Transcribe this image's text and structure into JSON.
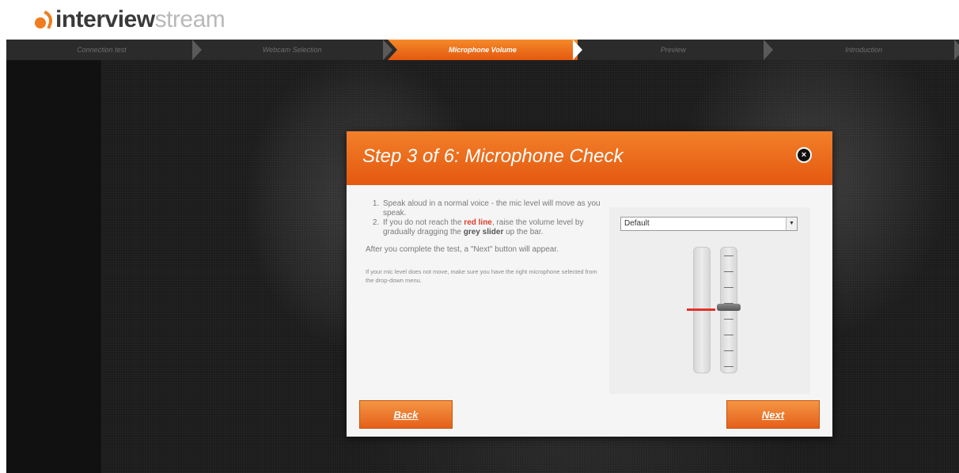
{
  "logo": {
    "strong": "interview",
    "light": "stream"
  },
  "steps": [
    {
      "label": "Connection test"
    },
    {
      "label": "Webcam Selection"
    },
    {
      "label": "Microphone Volume"
    },
    {
      "label": "Preview"
    },
    {
      "label": "Introduction"
    }
  ],
  "active_step_index": 2,
  "dialog": {
    "title": "Step 3 of 6: Microphone Check",
    "close_symbol": "×",
    "instructions": {
      "item1": "Speak aloud in a normal voice - the mic level will move as you speak.",
      "item2_a": "If you do not reach the ",
      "item2_red": "red line",
      "item2_b": ", raise the volume level by gradually dragging the ",
      "item2_bold": "grey slider",
      "item2_c": " up the bar."
    },
    "after_text": "After you complete the test, a \"Next\" button will appear.",
    "note": "If your mic level does not move, make sure you have the right microphone selected from the drop-down menu.",
    "mic_select_value": "Default",
    "caret_symbol": "▼",
    "back_label": "Back",
    "next_label": "Next"
  },
  "colors": {
    "accent": "#e4580f",
    "red_line": "#e2312a"
  },
  "icons": {
    "close": "close-icon",
    "dropdown": "chevron-down-icon",
    "logo": "logo-icon"
  }
}
